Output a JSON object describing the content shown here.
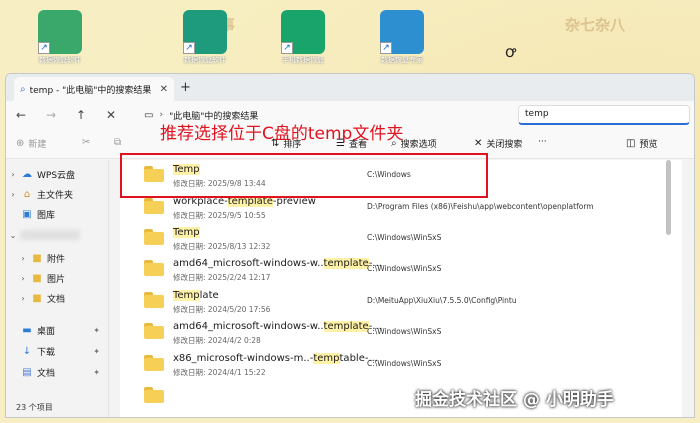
{
  "desktop": {
    "icons": [
      {
        "caption": "数据恢复软件",
        "color": "#3aa86b"
      },
      {
        "caption": "数据恢复软件",
        "color": "#1e9a7d"
      },
      {
        "caption": "手机数据恢复",
        "color": "#19a46c"
      },
      {
        "caption": "数据恢复专家",
        "color": "#2d8fd0"
      }
    ],
    "deco_left": "待办事",
    "deco_right": "杂七杂八"
  },
  "window": {
    "tab_label": "temp - \"此电脑\"中的搜索结果",
    "address_text": "\"此电脑\"中的搜索结果",
    "search_value": "temp",
    "toolbar": {
      "new": "新建",
      "sort": "排序",
      "view": "查看",
      "search_options": "搜索选项",
      "close_search": "关闭搜索",
      "more": "···",
      "preview": "预览"
    },
    "sidebar": [
      {
        "label": "WPS云盘",
        "icon": "cloud-icon"
      },
      {
        "label": "主文件夹",
        "icon": "home-icon"
      },
      {
        "label": "图库",
        "icon": "gallery-icon"
      },
      {
        "label": "附件",
        "icon": "folder-icon"
      },
      {
        "label": "图片",
        "icon": "folder-icon"
      },
      {
        "label": "文档",
        "icon": "folder-icon"
      },
      {
        "label": "桌面",
        "icon": "desktop-icon"
      },
      {
        "label": "下载",
        "icon": "download-icon"
      },
      {
        "label": "文档",
        "icon": "document-icon"
      }
    ],
    "status": "23 个项目",
    "results": [
      {
        "pre": "",
        "match": "Temp",
        "post": "",
        "date": "修改日期: 2025/9/8 13:44",
        "path": "C:\\Windows"
      },
      {
        "pre": "workplace-",
        "match": "template",
        "post": "-preview",
        "date": "修改日期: 2025/9/5 10:55",
        "path": "D:\\Program Files (x86)\\Feishu\\app\\webcontent\\openplatform"
      },
      {
        "pre": "",
        "match": "Temp",
        "post": "",
        "date": "修改日期: 2025/8/13 12:32",
        "path": "C:\\Windows\\WinSxS"
      },
      {
        "pre": "amd64_microsoft-windows-w..",
        "match": "template",
        "post": "-...",
        "date": "修改日期: 2025/2/24 12:17",
        "path": "C:\\Windows\\WinSxS"
      },
      {
        "pre": "",
        "match": "Temp",
        "post": "late",
        "date": "修改日期: 2024/5/20 17:56",
        "path": "D:\\MeituApp\\XiuXiu\\7.5.5.0\\Config\\Pintu"
      },
      {
        "pre": "amd64_microsoft-windows-w..",
        "match": "template",
        "post": "-...",
        "date": "修改日期: 2024/4/2 0:28",
        "path": "C:\\Windows\\WinSxS"
      },
      {
        "pre": "x86_microsoft-windows-m..-",
        "match": "temp",
        "post": "table-...",
        "date": "修改日期: 2024/4/1 15:22",
        "path": "C:\\Windows\\WinSxS"
      }
    ]
  },
  "annotation": "推荐选择位于C盘的temp文件夹",
  "watermark": "掘金技术社区 @ 小明助手"
}
